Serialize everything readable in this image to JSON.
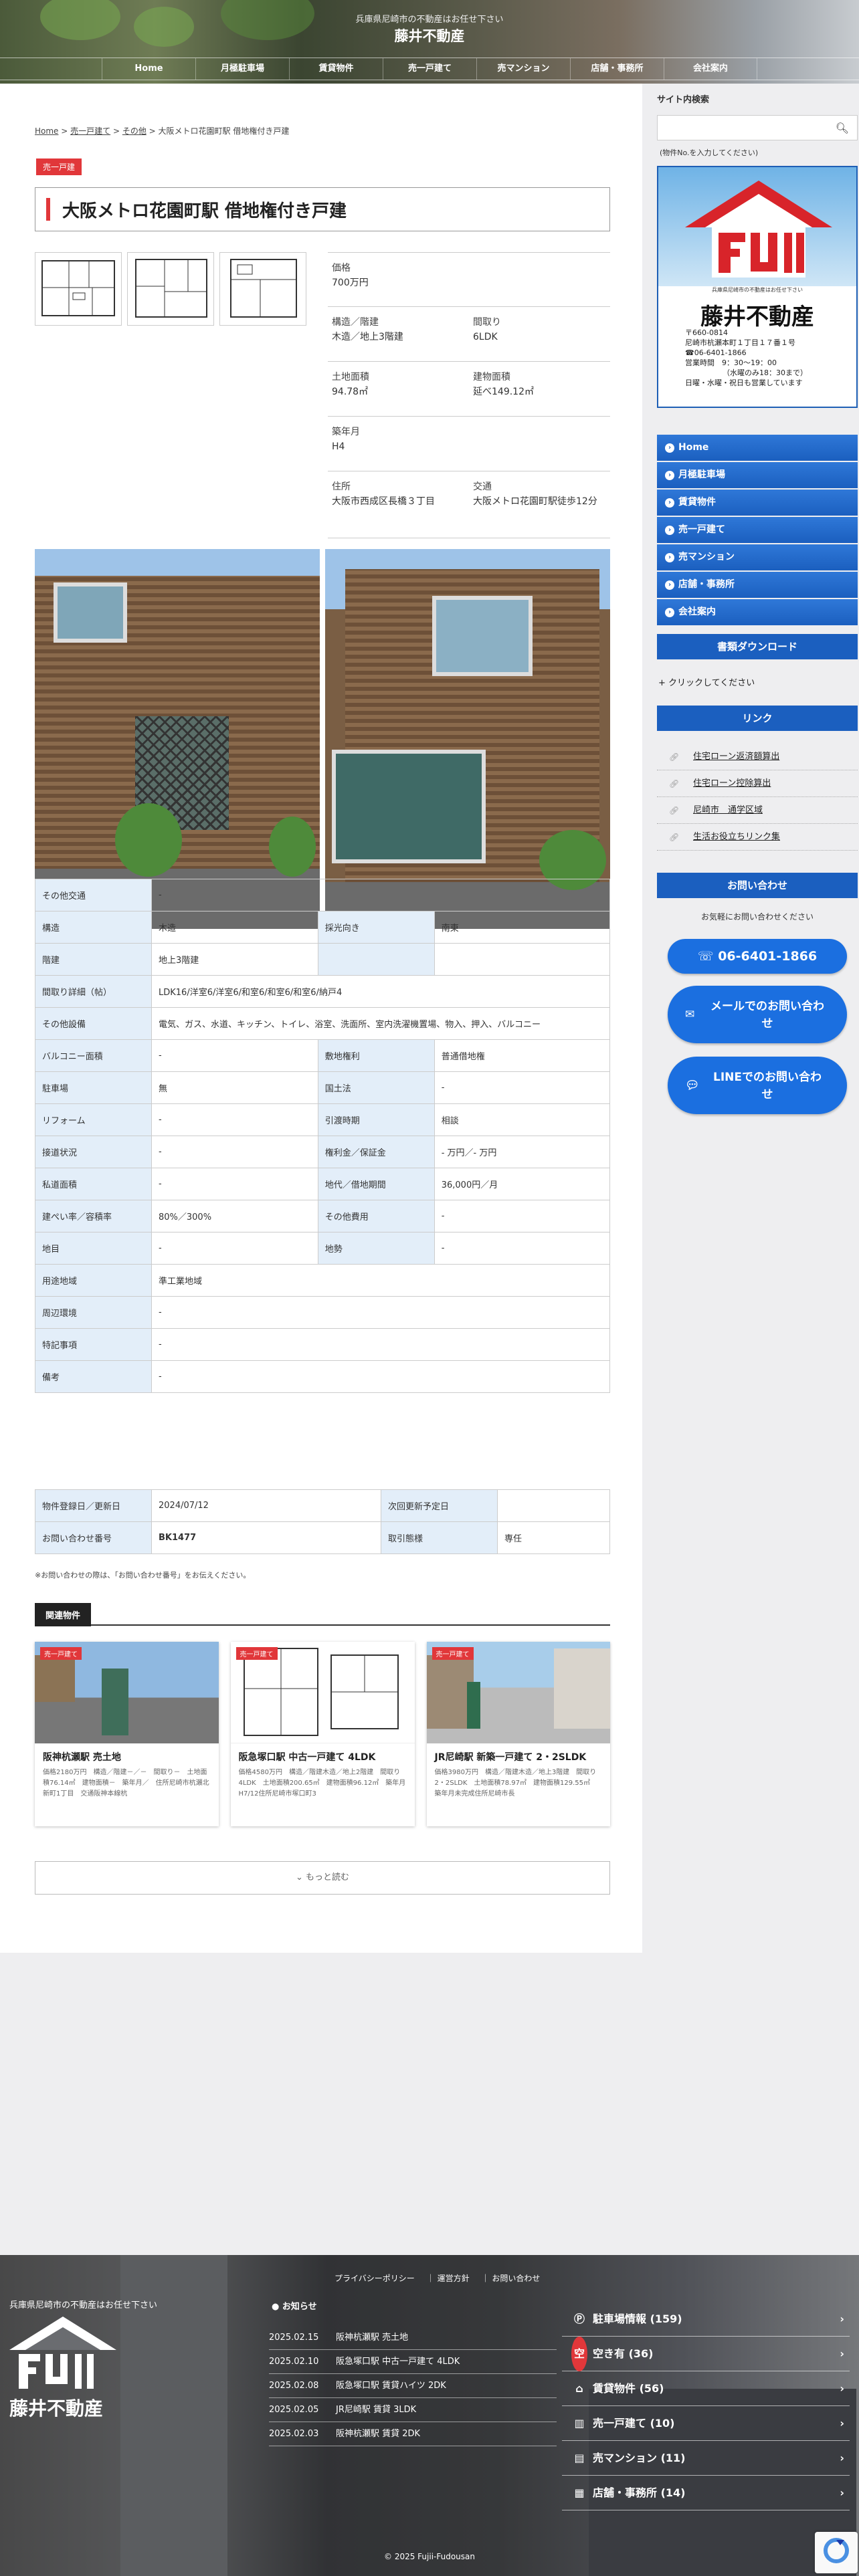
{
  "header": {
    "tagline": "兵庫県尼崎市の不動産はお任せ下さい",
    "title": "藤井不動産",
    "nav": [
      "Home",
      "月極駐車場",
      "賃貸物件",
      "売一戸建て",
      "売マンション",
      "店舗・事務所",
      "会社案内"
    ]
  },
  "breadcrumb": {
    "home": "Home",
    "sep1": " > ",
    "c1": "売一戸建て",
    "sep2": " > ",
    "c2": "その他",
    "sep3": " > ",
    "current": "大阪メトロ花園町駅 借地権付き戸建"
  },
  "property": {
    "tag": "売一戸建",
    "title": "大阪メトロ花園町駅 借地権付き戸建",
    "specs": {
      "price_k": "価格",
      "price_v": "700万円",
      "structure_k": "構造／階建",
      "structure_v": "木造／地上3階建",
      "layout_k": "間取り",
      "layout_v": "6LDK",
      "land_k": "土地面積",
      "land_v": "94.78㎡",
      "bldg_k": "建物面積",
      "bldg_v": "延べ149.12㎡",
      "age_k": "築年月",
      "age_v": "H4",
      "addr_k": "住所",
      "addr_v": "大阪市西成区長橋３丁目",
      "traffic_k": "交通",
      "traffic_v": "大阪メトロ花園町駅徒歩12分"
    }
  },
  "details": {
    "r1k": "その他交通",
    "r1v": "-",
    "r2k": "構造",
    "r2v": "木造",
    "r2k2": "採光向き",
    "r2v2": "南東",
    "r3k": "階建",
    "r3v": "地上3階建",
    "r3k2": "",
    "r3v2": "",
    "r4k": "間取り詳細（帖）",
    "r4v": "LDK16/洋室6/洋室6/和室6/和室6/和室6/納戸4",
    "r5k": "その他設備",
    "r5v": "電気、ガス、水道、キッチン、トイレ、浴室、洗面所、室内洗濯機置場、物入、押入、バルコニー",
    "r6k": "バルコニー面積",
    "r6v": "-",
    "r6k2": "敷地権利",
    "r6v2": "普通借地権",
    "r7k": "駐車場",
    "r7v": "無",
    "r7k2": "国土法",
    "r7v2": "-",
    "r8k": "リフォーム",
    "r8v": "-",
    "r8k2": "引渡時期",
    "r8v2": "相談",
    "r9k": "接道状況",
    "r9v": "-",
    "r9k2": "権利金／保証金",
    "r9v2": "- 万円／- 万円",
    "r10k": "私道面積",
    "r10v": "-",
    "r10k2": "地代／借地期間",
    "r10v2": "36,000円／月",
    "r11k": "建ぺい率／容積率",
    "r11v": "80%／300%",
    "r11k2": "その他費用",
    "r11v2": "-",
    "r12k": "地目",
    "r12v": "-",
    "r12k2": "地勢",
    "r12v2": "-",
    "r13k": "用途地域",
    "r13v": "準工業地域",
    "r14k": "周辺環境",
    "r14v": "-",
    "r15k": "特記事項",
    "r15v": "-",
    "r16k": "備考",
    "r16v": "-"
  },
  "meta": {
    "reg_k": "物件登録日／更新日",
    "reg_v": "2024/07/12",
    "next_k": "次回更新予定日",
    "next_v": "",
    "no_k": "お問い合わせ番号",
    "no_v": "BK1477",
    "deal_k": "取引態様",
    "deal_v": "専任"
  },
  "note": "※お問い合わせの際は、「お問い合わせ番号」をお伝えください。",
  "related": {
    "heading": "関連物件",
    "cards": [
      {
        "tag": "売一戸建て",
        "title": "阪神杭瀬駅 売土地",
        "desc": "価格2180万円　構造／階建－／－　間取り－　土地面積76.14㎡　建物面積－　築年月／　住所尼崎市杭瀬北新町1丁目　交通阪神本線杭"
      },
      {
        "tag": "売一戸建て",
        "title": "阪急塚口駅 中古一戸建て 4LDK",
        "desc": "価格4580万円　構造／階建木造／地上2階建　間取り4LDK　土地面積200.65㎡　建物面積96.12㎡　築年月H7/12住所尼崎市塚口町3"
      },
      {
        "tag": "売一戸建て",
        "title": "JR尼崎駅 新築一戸建て 2・2SLDK",
        "desc": "価格3980万円　構造／階建木造／地上3階建　間取り2・2SLDK　土地面積78.97㎡　建物面積129.55㎡　築年月未完成住所尼崎市長"
      }
    ],
    "more": "もっと読む"
  },
  "sidebar": {
    "search_heading": "サイト内検索",
    "search_placeholder": "",
    "search_note": "(物件No.を入力してください)",
    "company_small": "兵庫県尼崎市の不動産はお任せ下さい",
    "company_name": "藤井不動産",
    "zip": "〒660-0814",
    "addr": "尼崎市杭瀬本町１丁目１７番１号",
    "tel": "☎06-6401-1866",
    "hours": "営業時間　9：30～19：00",
    "hours2": "（水曜のみ18：30まで）",
    "holiday": "日曜・水曜・祝日も営業しています",
    "menu": [
      "Home",
      "月極駐車場",
      "賃貸物件",
      "売一戸建て",
      "売マンション",
      "店舗・事務所",
      "会社案内"
    ],
    "download_title": "書類ダウンロード",
    "download_link": "+ クリックしてください",
    "links_title": "リンク",
    "links": [
      "住宅ローン返済額算出",
      "住宅ローン控除算出",
      "尼崎市　通学区域",
      "生活お役立ちリンク集"
    ],
    "contact_title": "お問い合わせ",
    "contact_note": "お気軽にお問い合わせください",
    "tel_btn": "06-6401-1866",
    "mail_btn": "メールでのお問い合わせ",
    "line_btn": "LINEでのお問い合わせ"
  },
  "footer": {
    "tagline": "兵庫県尼崎市の不動産はお任せ下さい",
    "name": "藤井不動産",
    "links": [
      "プライバシーポリシー",
      "｜ 運営方針",
      "｜ お問い合わせ"
    ],
    "news_heading": "お知らせ",
    "news": [
      {
        "date": "2025.02.15",
        "text": "阪神杭瀬駅 売土地"
      },
      {
        "date": "2025.02.10",
        "text": "阪急塚口駅 中古一戸建て 4LDK"
      },
      {
        "date": "2025.02.08",
        "text": "阪急塚口駅 賃貸ハイツ 2DK"
      },
      {
        "date": "2025.02.05",
        "text": "JR尼崎駅 賃貸 3LDK"
      },
      {
        "date": "2025.02.03",
        "text": "阪神杭瀬駅 賃貸 2DK"
      }
    ],
    "cats": [
      {
        "label": "駐車場情報 (159)"
      },
      {
        "label": "空き有 (36)"
      },
      {
        "label": "賃貸物件 (56)"
      },
      {
        "label": "売一戸建て (10)"
      },
      {
        "label": "売マンション (11)"
      },
      {
        "label": "店舗・事務所 (14)"
      }
    ],
    "copyright": "© 2025 Fujii-Fudousan"
  },
  "colors": {
    "accent_red": "#e1373a",
    "brand_blue": "#1b5fbf",
    "table_key_bg": "#e3eef9"
  }
}
